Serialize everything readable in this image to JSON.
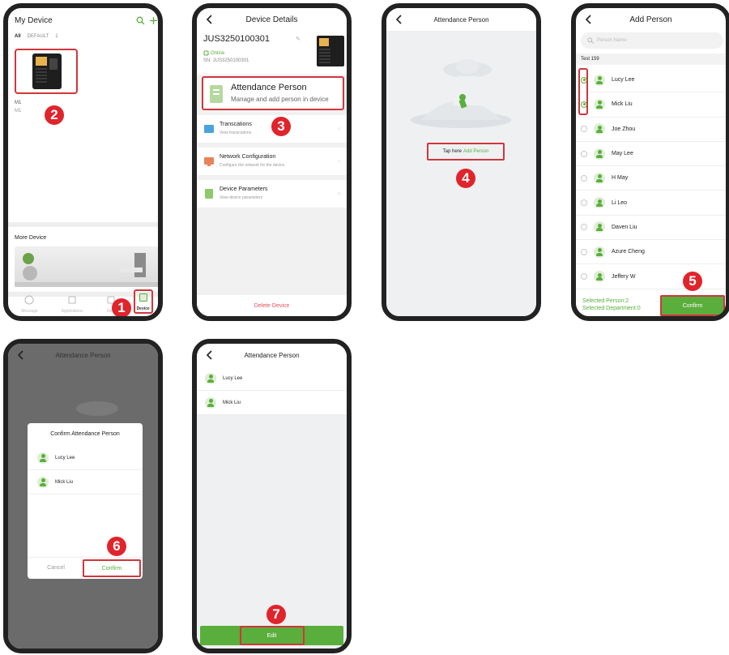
{
  "colors": {
    "accent": "#5aae3c",
    "marker": "#e0242c",
    "highlight_border": "#d0363c"
  },
  "steps": [
    "1",
    "2",
    "3",
    "4",
    "5",
    "6",
    "7"
  ],
  "screen1": {
    "title": "My Device",
    "filters": [
      "All",
      "DEFAULT",
      "1"
    ],
    "device_labels": [
      "M1",
      "M1"
    ],
    "more_device": "More Device",
    "nav": [
      "Message",
      "Applications",
      "Devi",
      "Device"
    ]
  },
  "screen2": {
    "title": "Device Details",
    "device_sn": "JUS3250100301",
    "status": "Online",
    "sn_line": "SN:  JUS3250100301",
    "attendance_title": "Attendance Person",
    "attendance_sub": "Manage and add person in device",
    "menu": [
      {
        "title": "Transcations",
        "sub": "View transcations"
      },
      {
        "title": "Network Configuration",
        "sub": "Configure the network for the device"
      },
      {
        "title": "Device Parameters",
        "sub": "View device parameters"
      }
    ],
    "delete": "Delete Device"
  },
  "screen3": {
    "title": "Attendance Person",
    "tap_prefix": "Tap here",
    "tap_link": "Add Person"
  },
  "screen4": {
    "title": "Add Person",
    "search_placeholder": "Person Name",
    "group": "Test 159",
    "people": [
      "Lucy Lee",
      "Mick Liu",
      "Joe Zhou",
      "May Lee",
      "H May",
      "Li Leo",
      "Daven Liu",
      "Azure Cheng",
      "Jeffery W"
    ],
    "selected_person": "Selected Person:2",
    "selected_dept": "Selected Department:0",
    "confirm": "Confirm"
  },
  "screen5": {
    "title": "Attendance Person",
    "dialog_title": "Confirm Attendance Person",
    "people": [
      "Lucy Lee",
      "Mick Liu"
    ],
    "cancel": "Cancel",
    "confirm": "Confirm"
  },
  "screen6": {
    "title": "Attendance Person",
    "people": [
      "Lucy Lee",
      "Mick Liu"
    ],
    "edit": "Edit"
  }
}
